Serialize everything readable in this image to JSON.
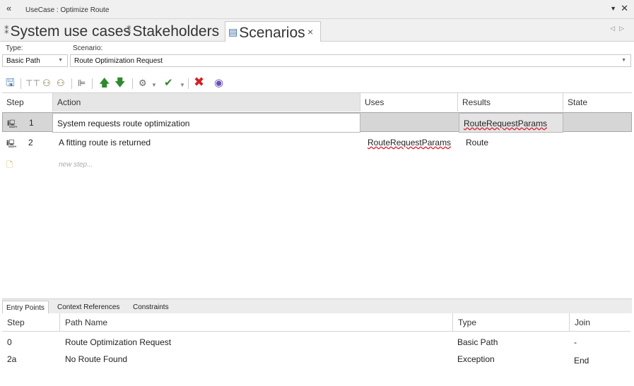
{
  "window": {
    "title": "UseCase : Optimize Route"
  },
  "tabs": [
    {
      "label": "System use cases",
      "icon": "use-case-icon"
    },
    {
      "label": "Stakeholders",
      "icon": "use-case-icon"
    },
    {
      "label": "Scenarios",
      "icon": "scenario-icon",
      "close": "×"
    }
  ],
  "form": {
    "type_label": "Type:",
    "type_value": "Basic Path",
    "scenario_label": "Scenario:",
    "scenario_value": "Route Optimization Request"
  },
  "grid": {
    "columns": [
      "Step",
      "Action",
      "Uses",
      "Results",
      "State"
    ],
    "rows": [
      {
        "step": "1",
        "action": "System requests route optimization",
        "uses": "",
        "results": "RouteRequestParams",
        "state": ""
      },
      {
        "step": "2",
        "action": "A fitting route is returned",
        "uses": "RouteRequestParams",
        "results": "Route",
        "state": ""
      }
    ],
    "new_step_placeholder": "new step..."
  },
  "bottom_tabs": [
    "Entry Points",
    "Context References",
    "Constraints"
  ],
  "entry_points": {
    "columns": [
      "Step",
      "Path Name",
      "Type",
      "Join"
    ],
    "rows": [
      {
        "step": "0",
        "path": "Route Optimization Request",
        "type": "Basic Path",
        "join": "-"
      },
      {
        "step": "2a",
        "path": "No Route Found",
        "type": "Exception",
        "join": "End"
      }
    ]
  },
  "colors": {
    "accent": "#3b6ea5",
    "selected_row": "#d6d6d6",
    "delete_red": "#d42020",
    "move_green": "#2f8a2f"
  }
}
